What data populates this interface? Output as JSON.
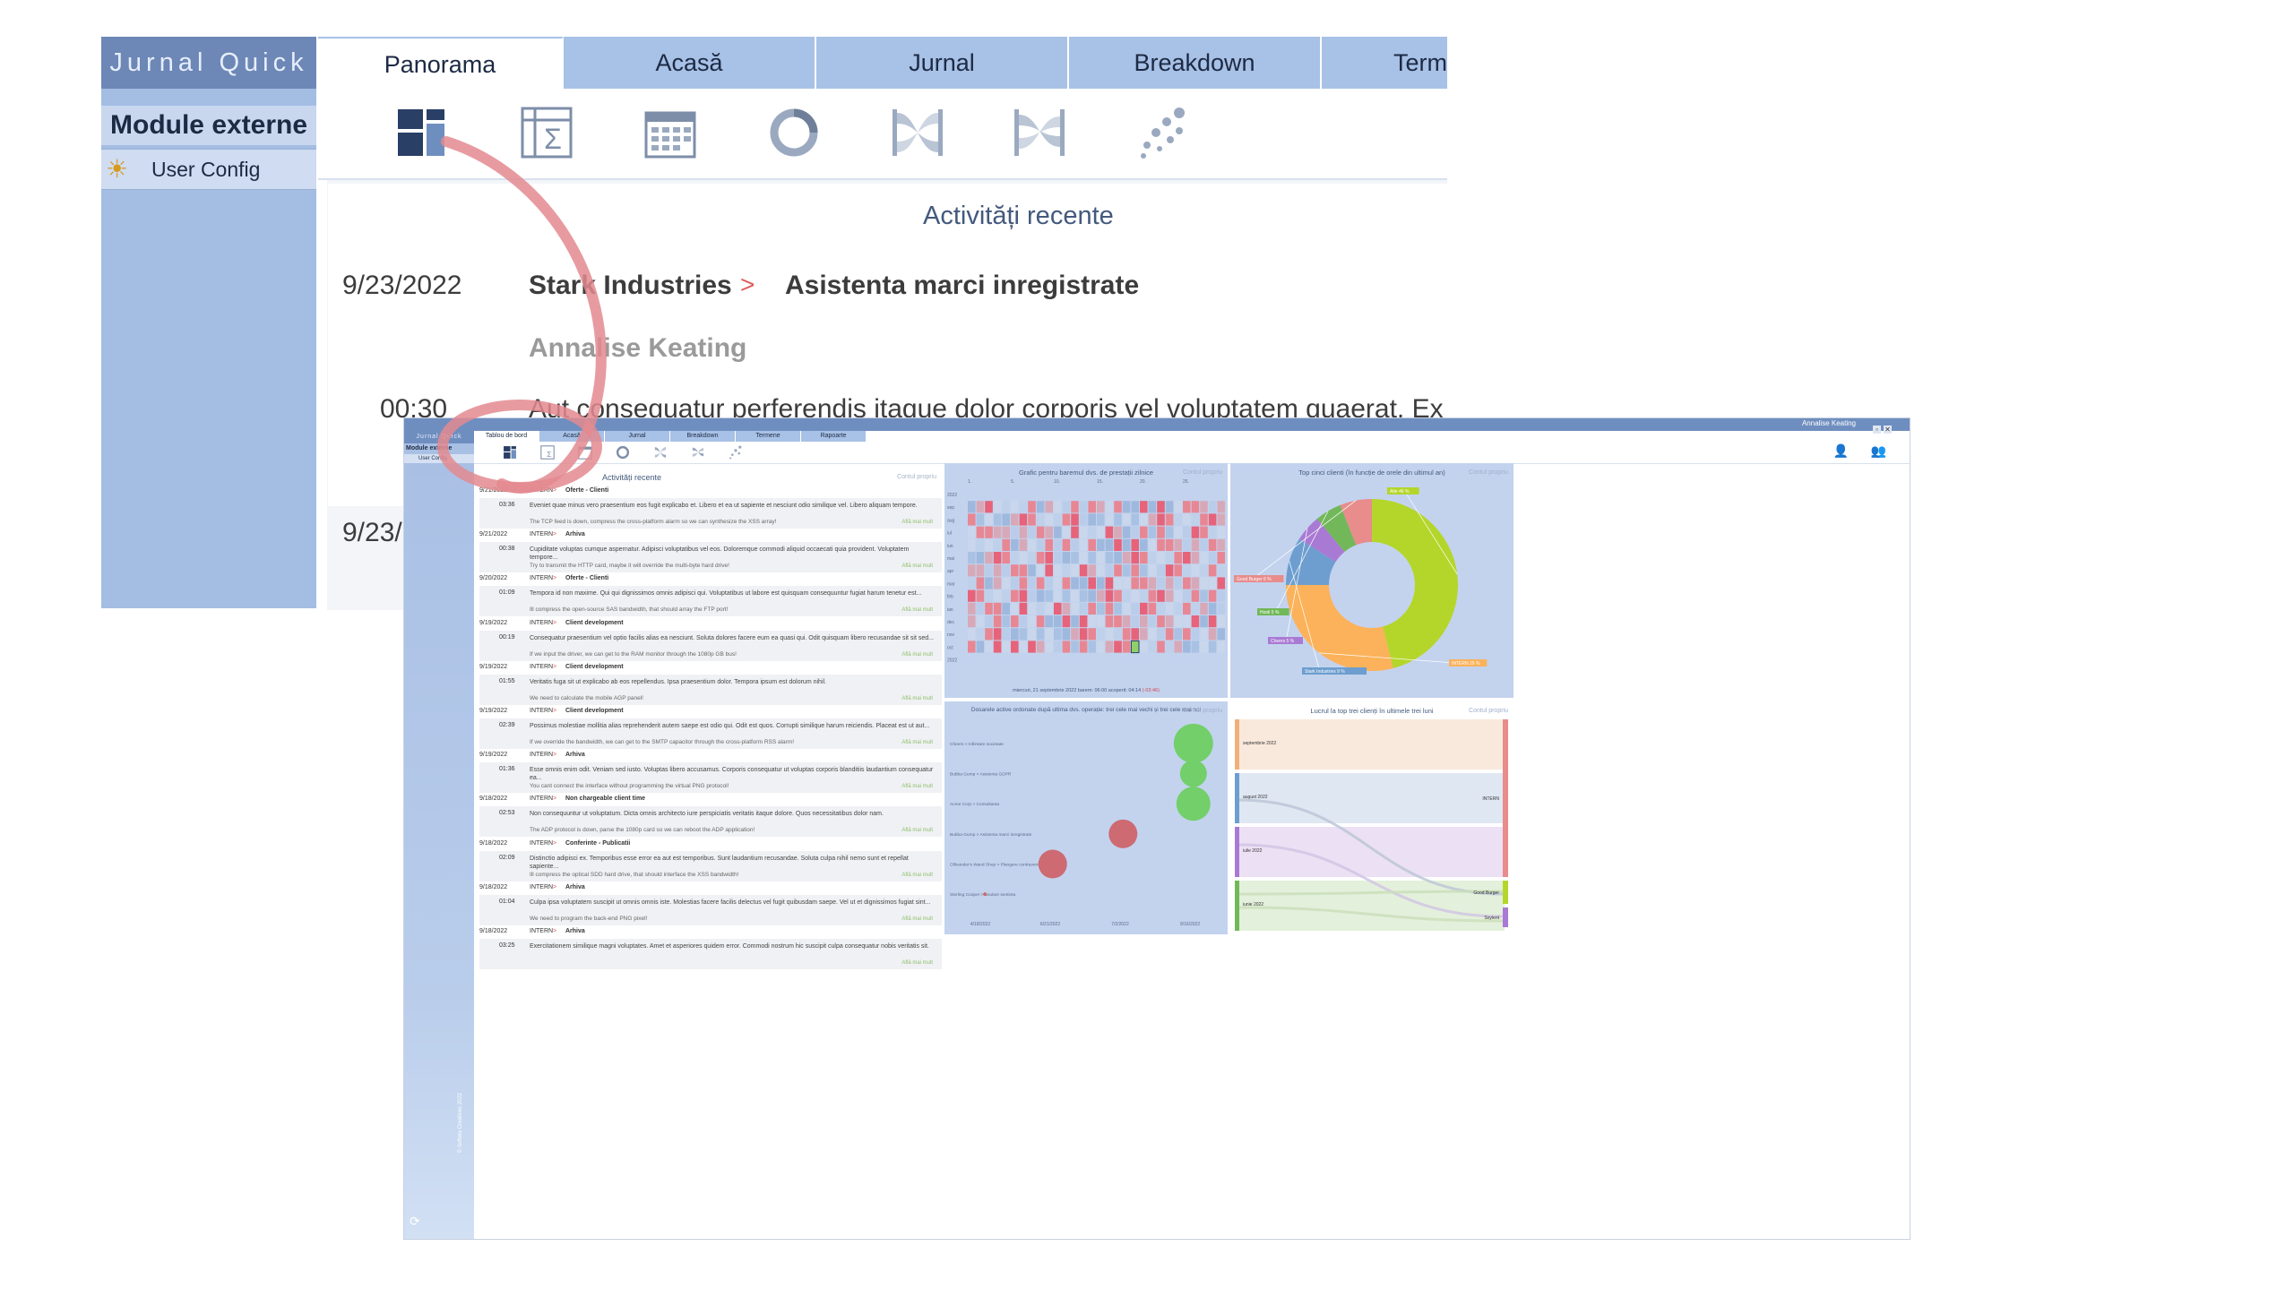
{
  "zoom": {
    "brand": "Jurnal Quick",
    "module_title": "Module externe",
    "user_config": "User Config",
    "tabs": [
      {
        "label": "Panorama",
        "active": true
      },
      {
        "label": "Acasă"
      },
      {
        "label": "Jurnal"
      },
      {
        "label": "Breakdown"
      },
      {
        "label": "Term"
      }
    ],
    "toolbar_icons": [
      "dashboard-icon",
      "sigma-table-icon",
      "calendar-icon",
      "donut-icon",
      "sankey-icon",
      "sankey-alt-icon",
      "scatter-icon"
    ],
    "activity_title": "Activități recente",
    "entry": {
      "date": "9/23/2022",
      "client": "Stark Industries",
      "separator": ">",
      "project": "Asistenta marci inregistrate",
      "person": "Annalise Keating",
      "time": "00:30",
      "description": "Aut consequatur perferendis itaque dolor corporis vel voluptatem quaerat. Ex nu"
    },
    "date2": "9/23/"
  },
  "inset": {
    "brand": "Jurnal Quick",
    "user_name": "Annalise Keating",
    "module_title": "Module externe",
    "user_config": "User Config",
    "copyright": "© Softeta Creatives 2022",
    "tabs": [
      {
        "label": "Tablou de bord",
        "active": true
      },
      {
        "label": "Acasă"
      },
      {
        "label": "Jurnal"
      },
      {
        "label": "Breakdown"
      },
      {
        "label": "Termene"
      },
      {
        "label": "Rapoarte"
      }
    ],
    "feed": {
      "title": "Activități recente",
      "own": "Contul propriu",
      "more": "Află mai mult",
      "entries": [
        {
          "date": "9/21/2022",
          "client": "INTERN",
          "project": "Oferte - Clienti",
          "time": "03:36",
          "desc": "Eveniet quae minus vero praesentium eos fugit explicabo et. Libero et ea ut sapiente et nesciunt odio similique vel. Libero aliquam tempore.",
          "note": "The TCP feed is down, compress the cross-platform alarm so we can synthesize the XSS array!"
        },
        {
          "date": "9/21/2022",
          "client": "INTERN",
          "project": "Arhiva",
          "time": "00:38",
          "desc": "Cupiditate voluptas cumque aspernatur. Adipisci voluptatibus vel eos. Doloremque commodi aliquid occaecati quia provident. Voluptatem tempore...",
          "note": "Try to transmit the HTTP card, maybe it will override the multi-byte hard drive!"
        },
        {
          "date": "9/20/2022",
          "client": "INTERN",
          "project": "Oferte - Clienti",
          "time": "01:09",
          "desc": "Tempora id non maxime. Qui qui dignissimos omnis adipisci qui. Voluptatibus ut labore est quisquam consequuntur fugiat harum tenetur est...",
          "note": "Ill compress the open-source SAS bandwidth, that should array the FTP port!"
        },
        {
          "date": "9/19/2022",
          "client": "INTERN",
          "project": "Client development",
          "time": "00:19",
          "desc": "Consequatur praesentium vel optio facilis alias ea nesciunt. Soluta dolores facere eum ea quasi qui. Odit quisquam libero recusandae sit sit sed...",
          "note": "If we input the driver, we can get to the RAM monitor through the 1080p GB bus!"
        },
        {
          "date": "9/19/2022",
          "client": "INTERN",
          "project": "Client development",
          "time": "01:55",
          "desc": "Veritatis fuga sit ut explicabo ab eos repellendus. Ipsa praesentium dolor. Tempora ipsum est dolorum nihil.",
          "note": "We need to calculate the mobile AGP panel!"
        },
        {
          "date": "9/19/2022",
          "client": "INTERN",
          "project": "Client development",
          "time": "02:39",
          "desc": "Possimus molestiae mollitia alias reprehenderit autem saepe est odio qui. Odit est quos. Corrupti similique harum reiciendis. Placeat est ut aut...",
          "note": "If we override the bandwidth, we can get to the SMTP capacitor through the cross-platform RSS alarm!"
        },
        {
          "date": "9/19/2022",
          "client": "INTERN",
          "project": "Arhiva",
          "time": "01:36",
          "desc": "Esse omnis enim odit. Veniam sed iusto. Voluptas libero accusamus. Corporis consequatur ut voluptas corporis blanditiis laudantium consequatur ea...",
          "note": "You cant connect the interface without programming the virtual PNG protocol!"
        },
        {
          "date": "9/18/2022",
          "client": "INTERN",
          "project": "Non chargeable client time",
          "time": "02:53",
          "desc": "Non consequuntur ut voluptatum. Dicta omnis architecto iure perspiciatis veritatis itaque dolore. Quos necessitatibus dolor nam.",
          "note": "The ADP protocol is down, parse the 1080p card so we can reboot the ADP application!"
        },
        {
          "date": "9/18/2022",
          "client": "INTERN",
          "project": "Conferinte - Publicatii",
          "time": "02:09",
          "desc": "Distinctio adipisci ex. Temporibus esse error ea aut est temporibus. Sunt laudantium recusandae. Soluta culpa nihil nemo sunt et repellat sapiente...",
          "note": "Ill compress the optical SDD hard drive, that should interface the XSS bandwidth!"
        },
        {
          "date": "9/18/2022",
          "client": "INTERN",
          "project": "Arhiva",
          "time": "01:04",
          "desc": "Culpa ipsa voluptatem suscipit ut omnis omnis iste. Molestias facere facilis delectus vel fugit quibusdam saepe. Vel ut et dignissimos fugiat sint...",
          "note": "We need to program the back-end PNG pixel!"
        },
        {
          "date": "9/18/2022",
          "client": "INTERN",
          "project": "Arhiva",
          "time": "03:25",
          "desc": "Exercitationem similique magni voluptates. Amet et asperiores quidem error. Commodi nostrum hic suscipit culpa consequatur nobis veritatis sit.",
          "note": ""
        }
      ]
    },
    "heatmap": {
      "title": "Grafic pentru baremul dvs. de prestații zilnice",
      "own": "Contul propriu",
      "row_labels": [
        "2022",
        "sep",
        "aug",
        "iul",
        "iun",
        "mai",
        "apr",
        "mar",
        "feb",
        "ian",
        "dec",
        "nov",
        "oct",
        "2022"
      ],
      "col_labels": [
        "1.",
        "5.",
        "10.",
        "15.",
        "20.",
        "25."
      ],
      "footer_prefix": "miercuri, 21 septembrie 2022  barem: 06:00  acoperit: 04:14",
      "footer_deficit": "(-03:46)"
    },
    "donut": {
      "title": "Top cinci clienti (în funcție de orele din ultimul an)",
      "own": "Contul propriu",
      "chart_data": {
        "type": "pie",
        "donut": true,
        "slices": [
          {
            "label": "Alte 46 %",
            "value": 46,
            "color": "#b4d62b"
          },
          {
            "label": "INTERN 29 %",
            "value": 29,
            "color": "#fbb25a"
          },
          {
            "label": "Stark Industries 9 %",
            "value": 9,
            "color": "#6d9ecf"
          },
          {
            "label": "Cheers 5 %",
            "value": 5,
            "color": "#a97ad4"
          },
          {
            "label": "Hooli 5 %",
            "value": 5,
            "color": "#72b85a"
          },
          {
            "label": "Good Burger 6 %",
            "value": 6,
            "color": "#e88c8c"
          }
        ]
      }
    },
    "bubble": {
      "title": "Dosarele active ordonate după ultima dvs. operație: trei cele mai vechi și trei cele mai noi",
      "own": "Contul propriu",
      "chart_data": {
        "type": "scatter",
        "x_ticks": [
          "4/18/2022",
          "6/21/2022",
          "7/2/2022",
          "9/16/2022"
        ],
        "points": [
          {
            "label": "Cheers > Infiintare societate",
            "x": 0.9,
            "size": 22,
            "color": "#72cf6a"
          },
          {
            "label": "Bubba Gump > Asistenta GDPR",
            "x": 0.9,
            "size": 15,
            "color": "#72cf6a"
          },
          {
            "label": "Acme Corp > Consultanta",
            "x": 0.9,
            "size": 19,
            "color": "#72cf6a"
          },
          {
            "label": "Bubba Gump > Asistenta marci inregistrate",
            "x": 0.64,
            "size": 16,
            "color": "#cd6a72"
          },
          {
            "label": "Ollivander's Wand Shop > Plangere contravenționala",
            "x": 0.38,
            "size": 16,
            "color": "#cd6a72"
          },
          {
            "label": "Sterling Cooper > Anulare sentinta",
            "x": 0.13,
            "size": 2,
            "color": "#cd6a72"
          }
        ]
      }
    },
    "sankey": {
      "title": "Lucrul la top trei clienți în ultimele trei luni",
      "own": "Contul propriu",
      "sources": [
        "septembrie 2022",
        "august 2022",
        "iulie 2022",
        "iunie 2022"
      ],
      "targets": [
        "INTERN",
        "Good Burger",
        "Soylent"
      ]
    }
  }
}
